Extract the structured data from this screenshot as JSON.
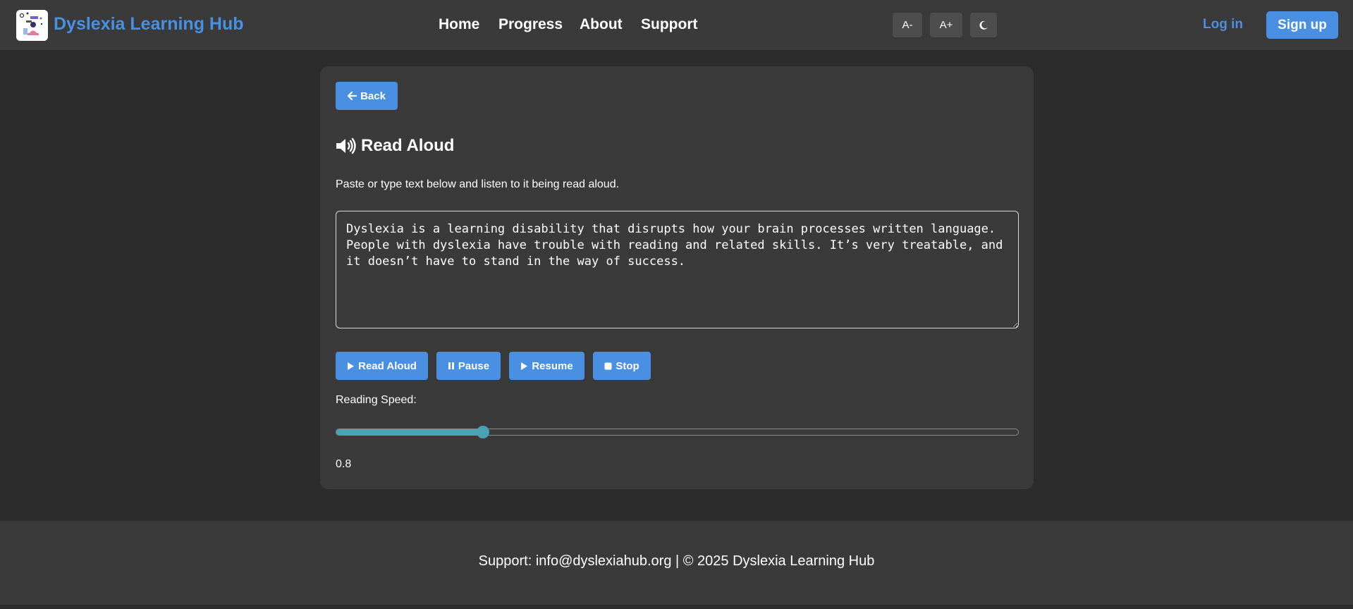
{
  "header": {
    "brand": "Dyslexia Learning Hub",
    "logo_icon": "reading-student-logo",
    "nav": [
      {
        "label": "Home"
      },
      {
        "label": "Progress"
      },
      {
        "label": "About"
      },
      {
        "label": "Support"
      }
    ],
    "tools": {
      "decrease_font_label": "A-",
      "increase_font_label": "A+",
      "dark_mode_icon": "moon-icon"
    },
    "login_label": "Log in",
    "signup_label": "Sign up"
  },
  "card": {
    "back_label": "Back",
    "title": "Read Aloud",
    "title_icon": "speaker-icon",
    "description": "Paste or type text below and listen to it being read aloud.",
    "textarea_value": "Dyslexia is a learning disability that disrupts how your brain processes written language. People with dyslexia have trouble with reading and related skills. It’s very treatable, and it doesn’t have to stand in the way of success.",
    "controls": {
      "read_aloud_label": "Read Aloud",
      "pause_label": "Pause",
      "resume_label": "Resume",
      "stop_label": "Stop"
    },
    "speed_label": "Reading Speed:",
    "speed_value_text": "0.8",
    "speed": {
      "value": 0.8,
      "fill_fraction": 0.215
    }
  },
  "footer": {
    "text": "Support: info@dyslexiahub.org | © 2025 Dyslexia Learning Hub"
  },
  "colors": {
    "accent": "#4a90e2",
    "slider": "#4aa3b5",
    "background": "#2c2c2c",
    "panel": "#3a3a3a"
  }
}
